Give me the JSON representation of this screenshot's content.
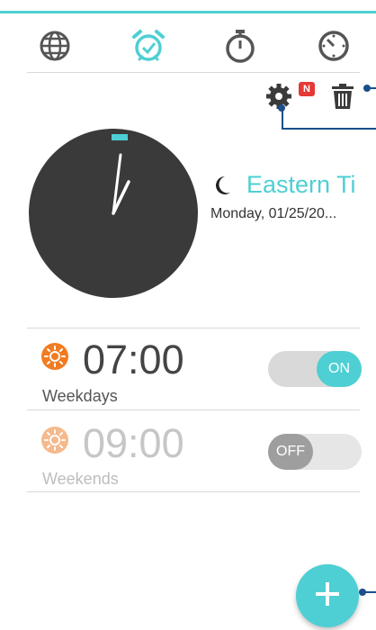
{
  "tabs": [
    {
      "name": "world-clock",
      "icon": "globe-icon",
      "active": false
    },
    {
      "name": "alarm",
      "icon": "alarm-clock-icon",
      "active": true
    },
    {
      "name": "stopwatch",
      "icon": "stopwatch-icon",
      "active": false
    },
    {
      "name": "timer",
      "icon": "timer-icon",
      "active": false
    }
  ],
  "toolbar": {
    "settings_icon": "gear-icon",
    "badge": "N",
    "delete_icon": "trash-icon"
  },
  "clock": {
    "hour_hand": "1 o'clock",
    "minute_hand": "~5 past"
  },
  "timezone": {
    "icon": "moon-icon",
    "name": "Eastern Ti",
    "date": "Monday, 01/25/20..."
  },
  "alarms": [
    {
      "time": "07:00",
      "label": "Weekdays",
      "icon": "sun-icon",
      "enabled": true,
      "toggle_label": "ON"
    },
    {
      "time": "09:00",
      "label": "Weekends",
      "icon": "sun-icon",
      "enabled": false,
      "toggle_label": "OFF"
    }
  ],
  "fab": {
    "icon": "plus-icon"
  },
  "colors": {
    "accent": "#4ecfd3",
    "clock_face": "#3a3a3a",
    "sun_active": "#f27b21",
    "sun_inactive": "#f6b98c",
    "callout": "#1b4e8a"
  }
}
